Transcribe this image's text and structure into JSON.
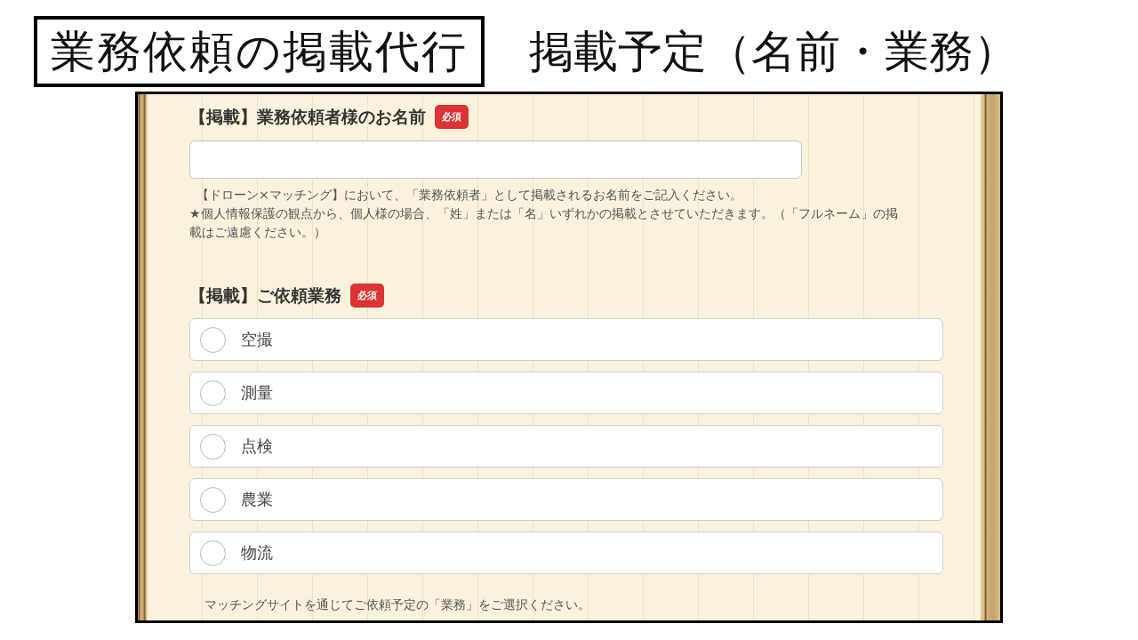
{
  "slide": {
    "title": "業務依頼の掲載代行",
    "subtitle": "掲載予定（名前・業務）"
  },
  "form": {
    "fields": [
      {
        "kind": "text",
        "label": "【掲載】業務依頼者様のお名前",
        "badge": "必須",
        "notes": [
          "【ドローン×マッチング】において、「業務依頼者」として掲載されるお名前をご記入ください。",
          "★個人情報保護の観点から、個人様の場合、「姓」または「名」いずれかの掲載とさせていただきます。（「フルネーム」の掲載はご遠慮ください。）"
        ]
      },
      {
        "kind": "radio",
        "label": "【掲載】ご依頼業務",
        "badge": "必須",
        "options": [
          {
            "label": "空撮",
            "selected": false
          },
          {
            "label": "測量",
            "selected": false
          },
          {
            "label": "点検",
            "selected": false
          },
          {
            "label": "農業",
            "selected": false
          },
          {
            "label": "物流",
            "selected": false
          }
        ],
        "notes": [
          "マッチングサイトを通じてご依頼予定の「業務」をご選択ください。"
        ]
      }
    ]
  }
}
